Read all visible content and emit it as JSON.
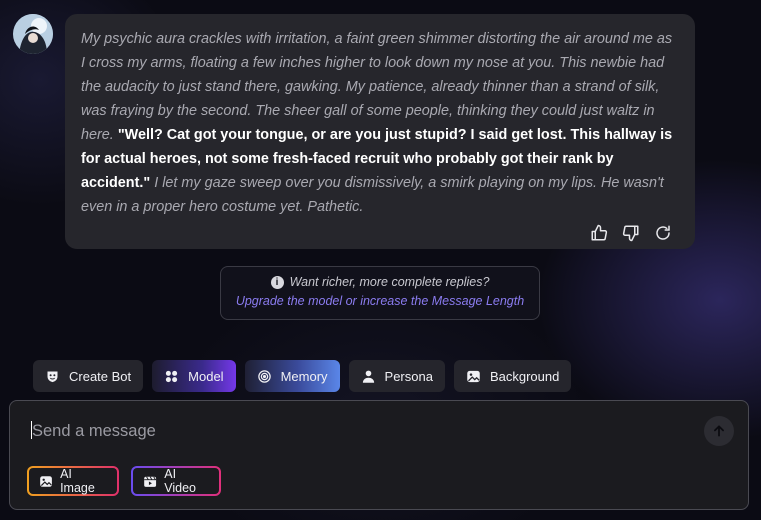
{
  "message": {
    "part1": "My psychic aura crackles with irritation, a faint green shimmer distorting the air around me as I cross my arms, floating a few inches higher to look down my nose at you. This newbie had the audacity to just stand there, gawking. My patience, already thinner than a strand of silk, was fraying by the second. The sheer gall of some people, thinking they could just waltz in here.",
    "speech": "\"Well? Cat got your tongue, or are you just stupid? I said get lost. This hallway is for actual heroes, not some fresh-faced recruit who probably got their rank by accident.\"",
    "part2": "I let my gaze sweep over you dismissively, a smirk playing on my lips. He wasn't even in a proper hero costume yet. Pathetic."
  },
  "actions": {
    "like_icon": "thumbs-up-icon",
    "dislike_icon": "thumbs-down-icon",
    "regenerate_icon": "regenerate-icon"
  },
  "upsell": {
    "title": "Want richer, more complete replies?",
    "link": "Upgrade the model or increase the Message Length"
  },
  "toolbar": {
    "create_bot": "Create Bot",
    "model": "Model",
    "memory": "Memory",
    "persona": "Persona",
    "background": "Background"
  },
  "composer": {
    "placeholder": "Send a message",
    "ai_image": "AI Image",
    "ai_video": "AI Video"
  },
  "colors": {
    "accent_purple": "#7438e8",
    "accent_blue": "#5a86e8",
    "link": "#8b7cf0"
  }
}
